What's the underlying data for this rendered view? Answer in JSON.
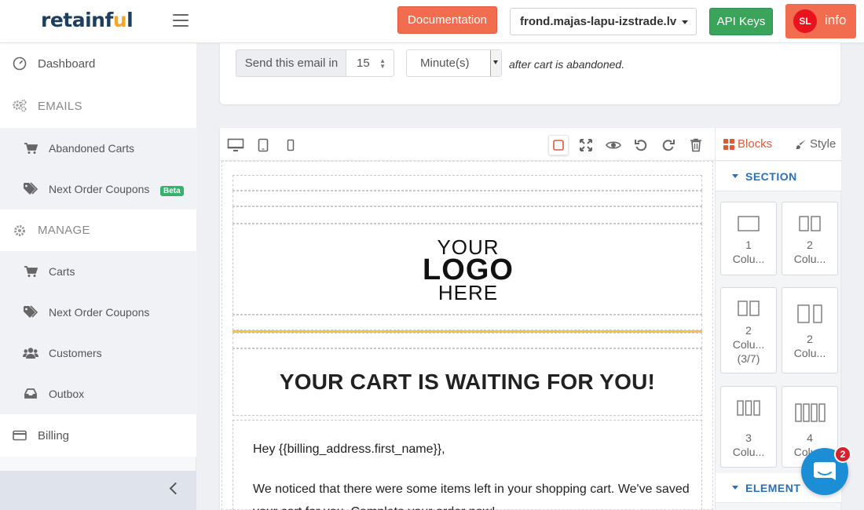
{
  "header": {
    "logo_main": "retainf",
    "logo_u": "u",
    "logo_end": "l",
    "documentation_label": "Documentation",
    "store_name": "frond.majas-lapu-izstrade.lv",
    "api_keys_label": "API Keys",
    "avatar_initials": "SL",
    "info_label": "info"
  },
  "sidebar": {
    "dashboard": "Dashboard",
    "emails_heading": "EMAILS",
    "abandoned_carts": "Abandoned Carts",
    "next_order_coupons_emails": "Next Order Coupons",
    "beta_badge": "Beta",
    "manage_heading": "MANAGE",
    "carts": "Carts",
    "next_order_coupons_manage": "Next Order Coupons",
    "customers": "Customers",
    "outbox": "Outbox",
    "billing": "Billing"
  },
  "delay": {
    "send_label": "Send this email in",
    "amount": "15",
    "unit": "Minute(s)",
    "after_text": "after cart is abandoned."
  },
  "email": {
    "logo_your": "YOUR",
    "logo_logo": "LOGO",
    "logo_here": "HERE",
    "headline": "YOUR CART IS WAITING FOR YOU!",
    "greeting": "Hey {{billing_address.first_name}},",
    "body": "We noticed that there were some items left in your shopping cart. We've saved your cart for you. Complete your order now!",
    "accent_color": "#f5c242"
  },
  "panel": {
    "tab_blocks": "Blocks",
    "tab_style": "Style",
    "section_heading": "SECTION",
    "element_heading": "ELEMENT",
    "blocks": [
      {
        "line1": "1",
        "line2": "Colu..."
      },
      {
        "line1": "2",
        "line2": "Colu..."
      },
      {
        "line1": "2",
        "line2": "Colu...",
        "line3": "(3/7)"
      },
      {
        "line1": "2",
        "line2": "Colu..."
      },
      {
        "line1": "3",
        "line2": "Colu..."
      },
      {
        "line1": "4",
        "line2": "Colu..."
      }
    ]
  },
  "chat": {
    "badge_count": "2"
  }
}
